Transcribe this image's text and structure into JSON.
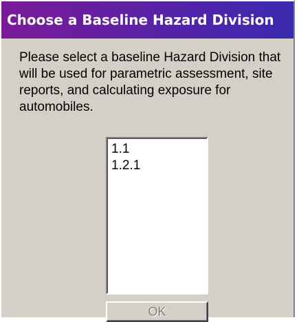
{
  "dialog": {
    "title": "Choose a Baseline Hazard Division",
    "description": "Please select a baseline Hazard Division that will be used for parametric assessment, site reports, and calculating exposure for automobiles.",
    "list_items": [
      "1.1",
      "1.2.1"
    ],
    "ok_label": "OK",
    "ok_enabled": false
  },
  "colors": {
    "title_gradient_start": "#7a1a98",
    "title_gradient_end": "#3a2ab0",
    "dialog_background": "#d4d0c8",
    "disabled_text": "#808080"
  }
}
